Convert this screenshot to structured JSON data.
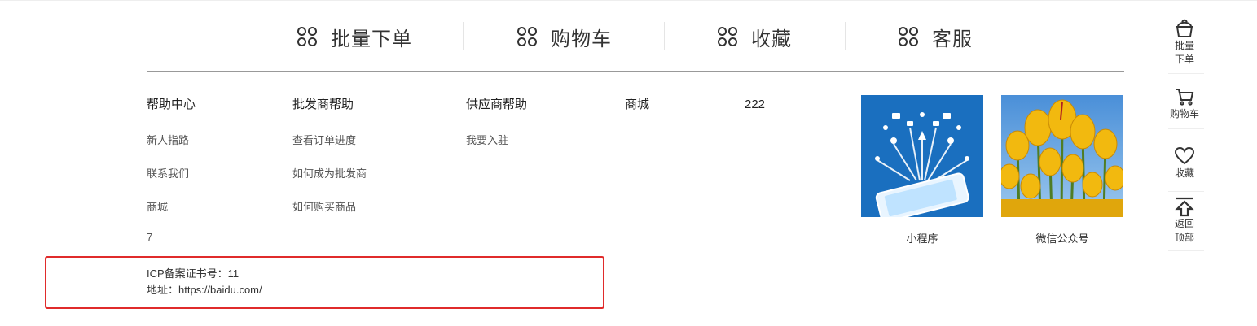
{
  "feature_nav": {
    "items": [
      {
        "label": "批量下单",
        "icon": "grid-icon"
      },
      {
        "label": "购物车",
        "icon": "grid-icon"
      },
      {
        "label": "收藏",
        "icon": "grid-icon"
      },
      {
        "label": "客服",
        "icon": "grid-icon"
      }
    ]
  },
  "help": {
    "columns": [
      {
        "title": "帮助中心",
        "links": [
          "新人指路",
          "联系我们",
          "商城"
        ]
      },
      {
        "title": "批发商帮助",
        "links": [
          "查看订单进度",
          "如何成为批发商",
          "如何购买商品"
        ]
      },
      {
        "title": "供应商帮助",
        "links": [
          "我要入驻"
        ]
      },
      {
        "title": "商城",
        "links": []
      },
      {
        "title": "222",
        "links": []
      }
    ],
    "extra": "7"
  },
  "footer_info": {
    "icp": "ICP备案证书号：11",
    "address": "地址：https://baidu.com/"
  },
  "qr_codes": [
    {
      "caption": "小程序",
      "image": "tech-smartphone-image"
    },
    {
      "caption": "微信公众号",
      "image": "tulips-image"
    }
  ],
  "sidebar": {
    "items": [
      {
        "line1": "批量",
        "line2": "下单",
        "icon": "basket-icon"
      },
      {
        "line1": "购物车",
        "icon": "cart-icon"
      },
      {
        "line1": "收藏",
        "icon": "heart-icon"
      },
      {
        "line1": "返回",
        "line2": "顶部",
        "icon": "arrow-up-icon"
      }
    ]
  },
  "colors": {
    "highlight_border": "#e02b2b",
    "divider": "#999999",
    "qr_blue": "#1a6fbf",
    "tulip_yellow": "#f2b90f"
  }
}
